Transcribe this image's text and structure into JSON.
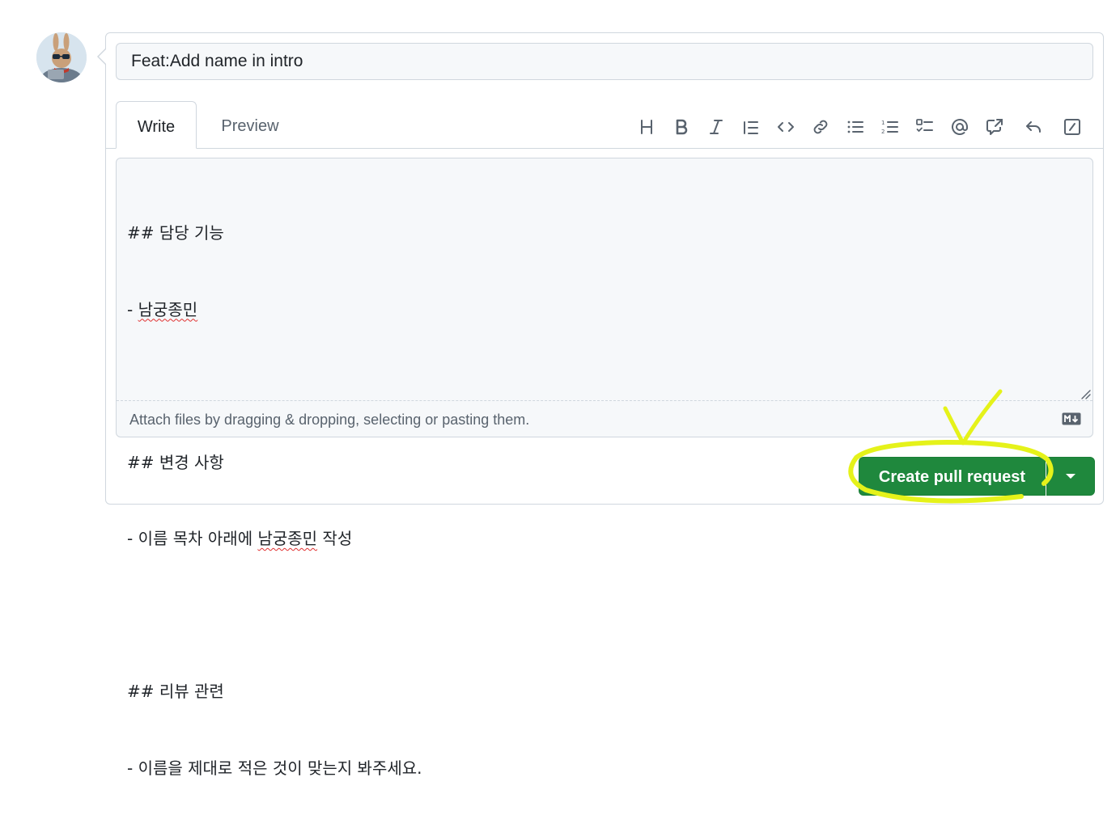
{
  "pr": {
    "title_value": "Feat:Add name in intro",
    "tabs": [
      {
        "label": "Write",
        "active": true
      },
      {
        "label": "Preview",
        "active": false
      }
    ],
    "toolbar_icons": [
      "heading-icon",
      "bold-icon",
      "italic-icon",
      "quote-icon",
      "code-icon",
      "link-icon",
      "unordered-list-icon",
      "ordered-list-icon",
      "task-list-icon",
      "mention-icon",
      "cross-reference-icon",
      "saved-reply-icon",
      "slash-commands-icon"
    ],
    "body_lines": [
      {
        "prefix": "## 담당 기능",
        "spell": ""
      },
      {
        "prefix": "- ",
        "spell": "남궁종민",
        "suffix": ""
      },
      {
        "prefix": "",
        "spell": ""
      },
      {
        "prefix": "## 변경 사항",
        "spell": ""
      },
      {
        "prefix": "- 이름 목차 아래에 ",
        "spell": "남궁종민",
        "suffix": " 작성"
      },
      {
        "prefix": "",
        "spell": ""
      },
      {
        "prefix": "## 리뷰 관련",
        "spell": ""
      },
      {
        "prefix": "- 이름을 제대로 적은 것이 맞는지 봐주세요.",
        "spell": ""
      }
    ],
    "attach_hint": "Attach files by dragging & dropping, selecting or pasting them.",
    "submit_label": "Create pull request"
  },
  "colors": {
    "primary_button": "#1f883d",
    "annotation_highlight": "#e5f21a",
    "border": "#d0d7de",
    "muted_text": "#59636e"
  }
}
